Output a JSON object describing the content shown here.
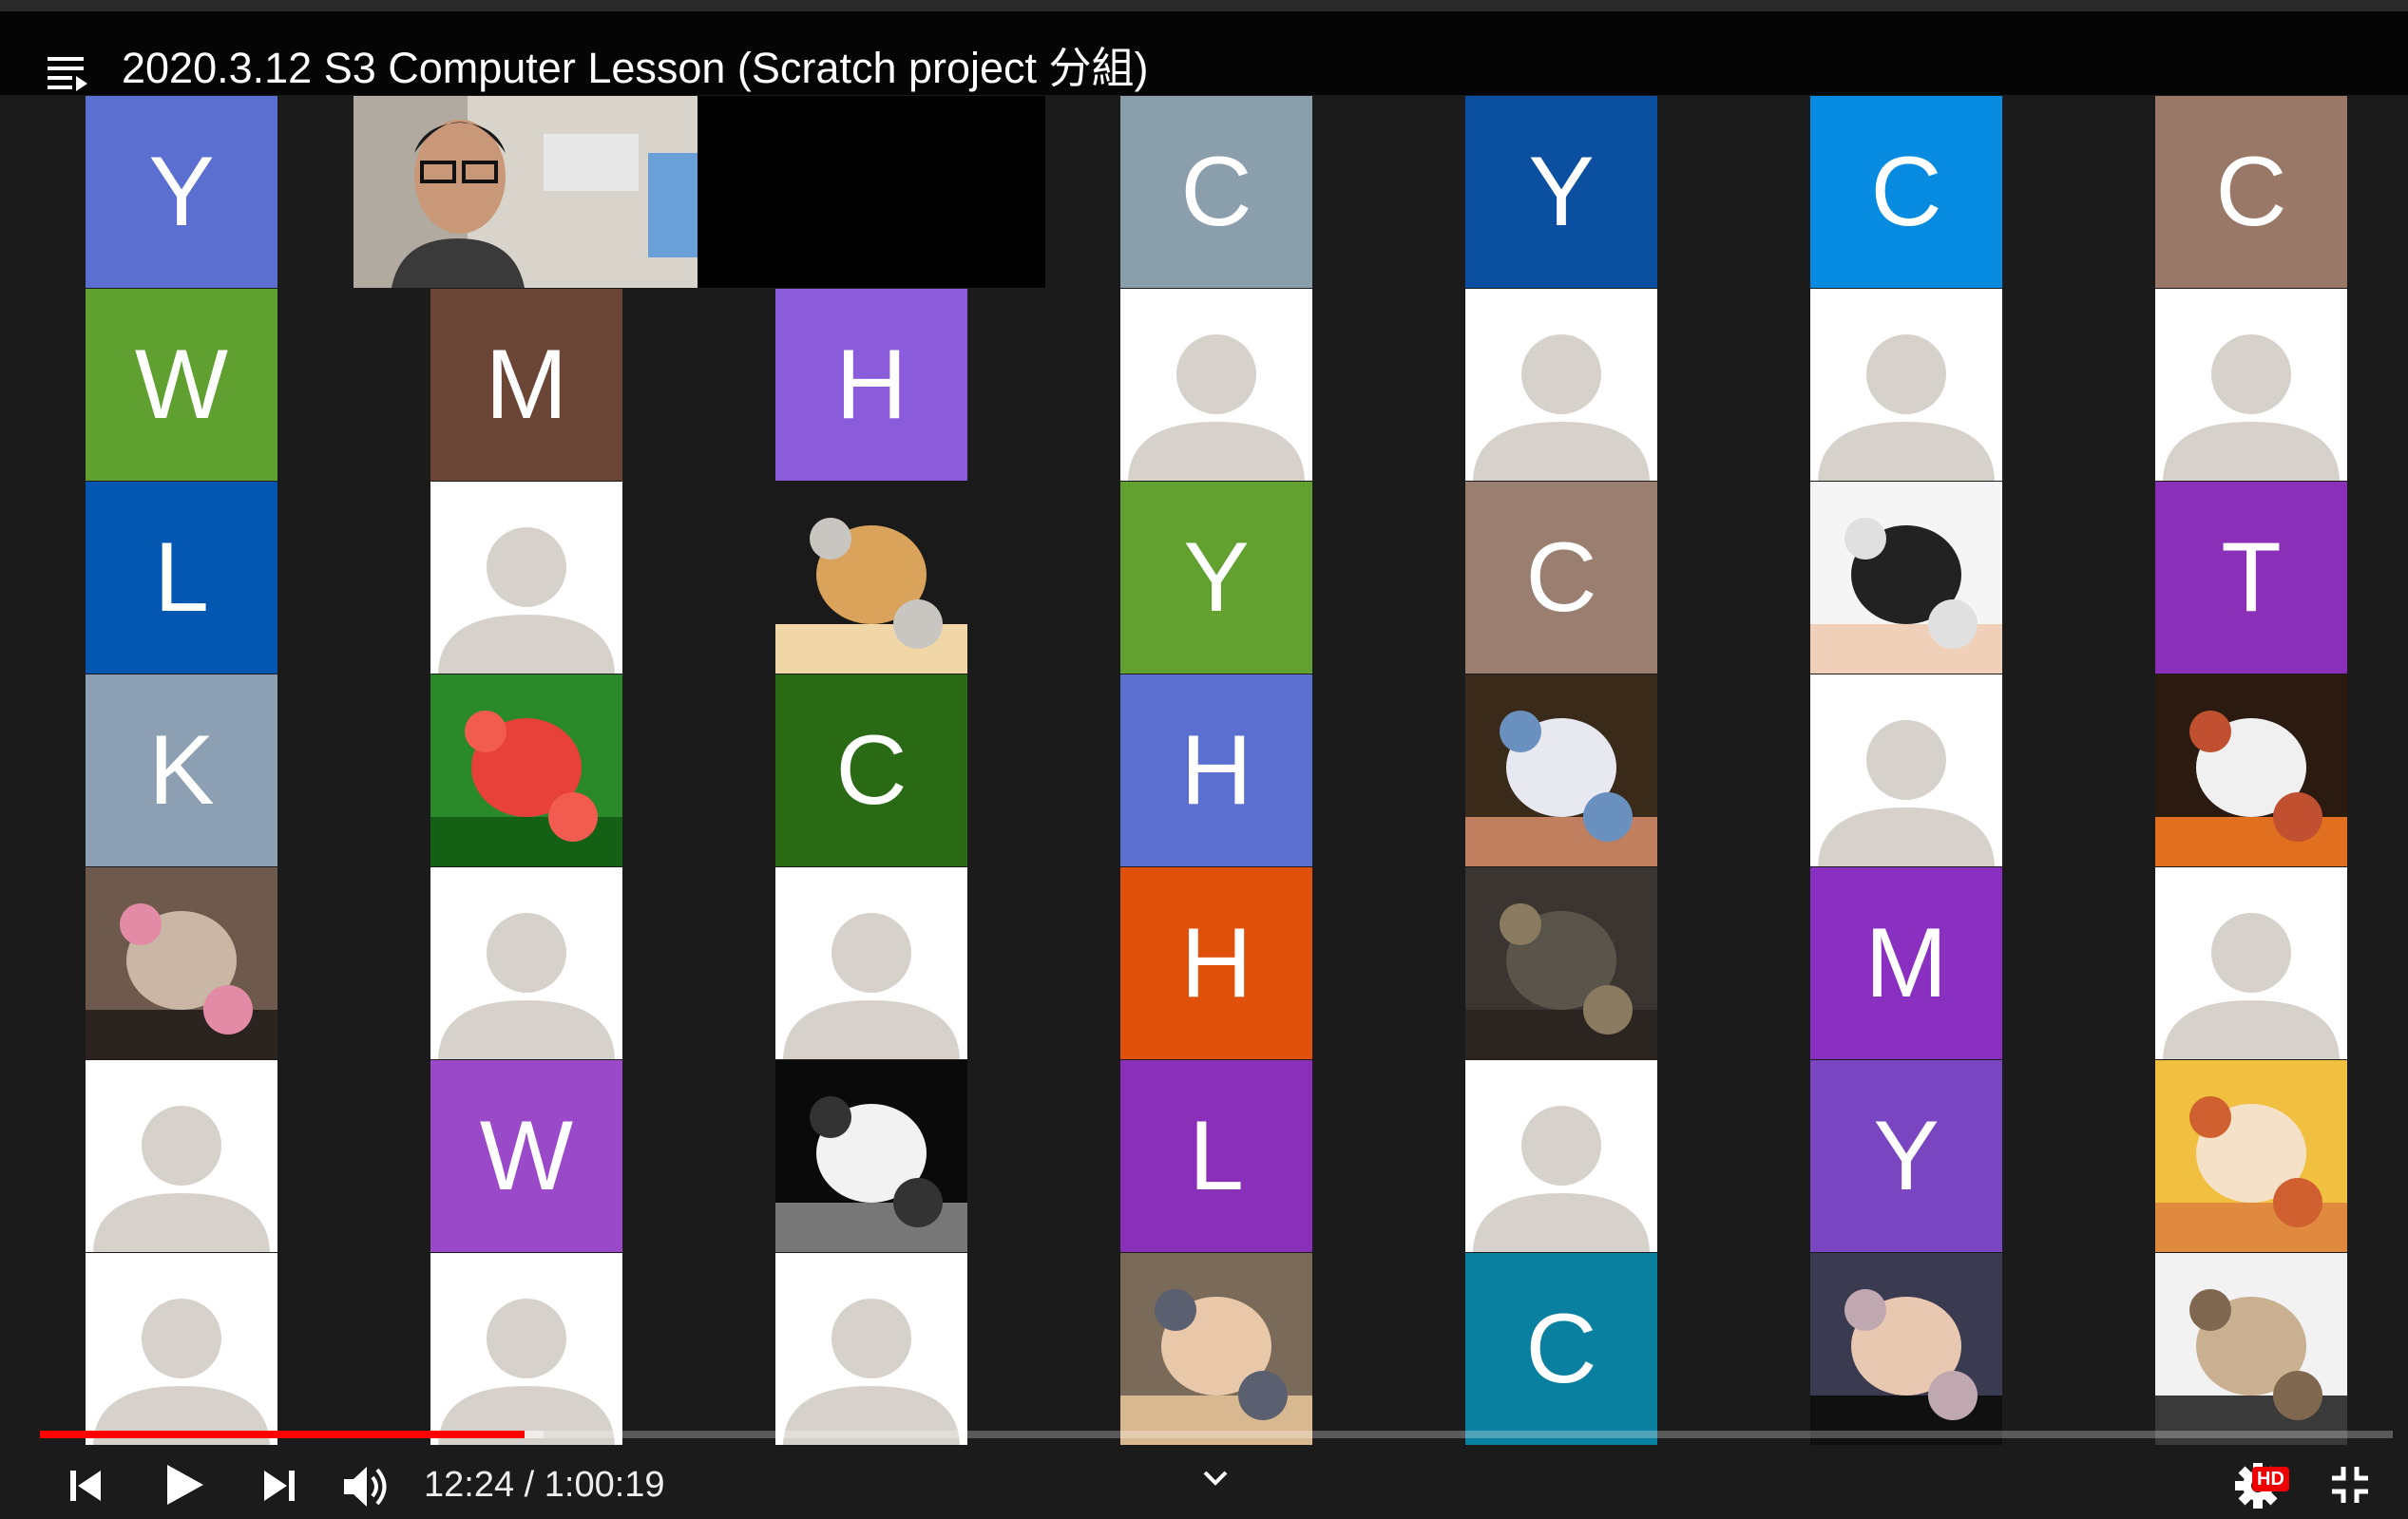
{
  "video": {
    "title": "2020.3.12 S3 Computer Lesson (Scratch project 分組)",
    "current_time": "12:24",
    "separator": " / ",
    "duration": "1:00:19",
    "progress_fraction": 0.206,
    "buffered_fraction": 0.214,
    "quality_badge": "HD"
  },
  "colors": {
    "progress": "#ff0000",
    "avatar_bg": "#ffffff",
    "avatar_silhouette": "#d6d2cb"
  },
  "grid": {
    "columns": [
      [
        {
          "type": "letter",
          "letter": "Y",
          "color": "#5b6fd0"
        },
        {
          "type": "letter",
          "letter": "W",
          "color": "#60a030"
        },
        {
          "type": "letter",
          "letter": "L",
          "color": "#0357b0"
        },
        {
          "type": "letter",
          "letter": "K",
          "color": "#8da0b3"
        },
        {
          "type": "photo",
          "label": "group-photo"
        },
        {
          "type": "avatar"
        },
        {
          "type": "avatar"
        }
      ],
      [
        {
          "type": "teacher-video"
        },
        {
          "type": "letter",
          "letter": "M",
          "color": "#6b4535"
        },
        {
          "type": "avatar"
        },
        {
          "type": "photo",
          "label": "watermelon-image"
        },
        {
          "type": "avatar"
        },
        {
          "type": "letter",
          "letter": "W",
          "color": "#9a4ac8"
        },
        {
          "type": "avatar"
        }
      ],
      [
        {
          "type": "empty"
        },
        {
          "type": "letter",
          "letter": "H",
          "color": "#8a5cdc"
        },
        {
          "type": "photo",
          "label": "hamster-image"
        },
        {
          "type": "letter",
          "letter": "C",
          "color": "#2b6a14"
        },
        {
          "type": "avatar"
        },
        {
          "type": "photo",
          "label": "astronaut-drawing"
        },
        {
          "type": "avatar"
        }
      ],
      [
        {
          "type": "letter",
          "letter": "C",
          "color": "#8a9eac"
        },
        {
          "type": "avatar"
        },
        {
          "type": "letter",
          "letter": "Y",
          "color": "#62a030"
        },
        {
          "type": "letter",
          "letter": "H",
          "color": "#5b6fd0"
        },
        {
          "type": "letter",
          "letter": "H",
          "color": "#e0500a"
        },
        {
          "type": "letter",
          "letter": "L",
          "color": "#8a30b8"
        },
        {
          "type": "photo",
          "label": "student-selfie"
        }
      ],
      [
        {
          "type": "letter",
          "letter": "Y",
          "color": "#0a4fa0"
        },
        {
          "type": "avatar"
        },
        {
          "type": "letter",
          "letter": "C",
          "color": "#9a7e70"
        },
        {
          "type": "photo",
          "label": "forky-image"
        },
        {
          "type": "photo",
          "label": "cats-on-sofa"
        },
        {
          "type": "avatar"
        },
        {
          "type": "letter",
          "letter": "C",
          "color": "#0a80a0"
        }
      ],
      [
        {
          "type": "letter",
          "letter": "C",
          "color": "#068be0"
        },
        {
          "type": "avatar"
        },
        {
          "type": "photo",
          "label": "celebrity-photo"
        },
        {
          "type": "avatar"
        },
        {
          "type": "letter",
          "letter": "M",
          "color": "#8a30c0"
        },
        {
          "type": "letter",
          "letter": "Y",
          "color": "#7a45c0"
        },
        {
          "type": "photo",
          "label": "friends-selfie"
        }
      ],
      [
        {
          "type": "letter",
          "letter": "C",
          "color": "#9a7868"
        },
        {
          "type": "avatar"
        },
        {
          "type": "letter",
          "letter": "T",
          "color": "#8a30b8"
        },
        {
          "type": "photo",
          "label": "olaf-image"
        },
        {
          "type": "avatar"
        },
        {
          "type": "photo",
          "label": "anime-girl-drawing"
        },
        {
          "type": "photo",
          "label": "band-photo"
        }
      ]
    ]
  }
}
